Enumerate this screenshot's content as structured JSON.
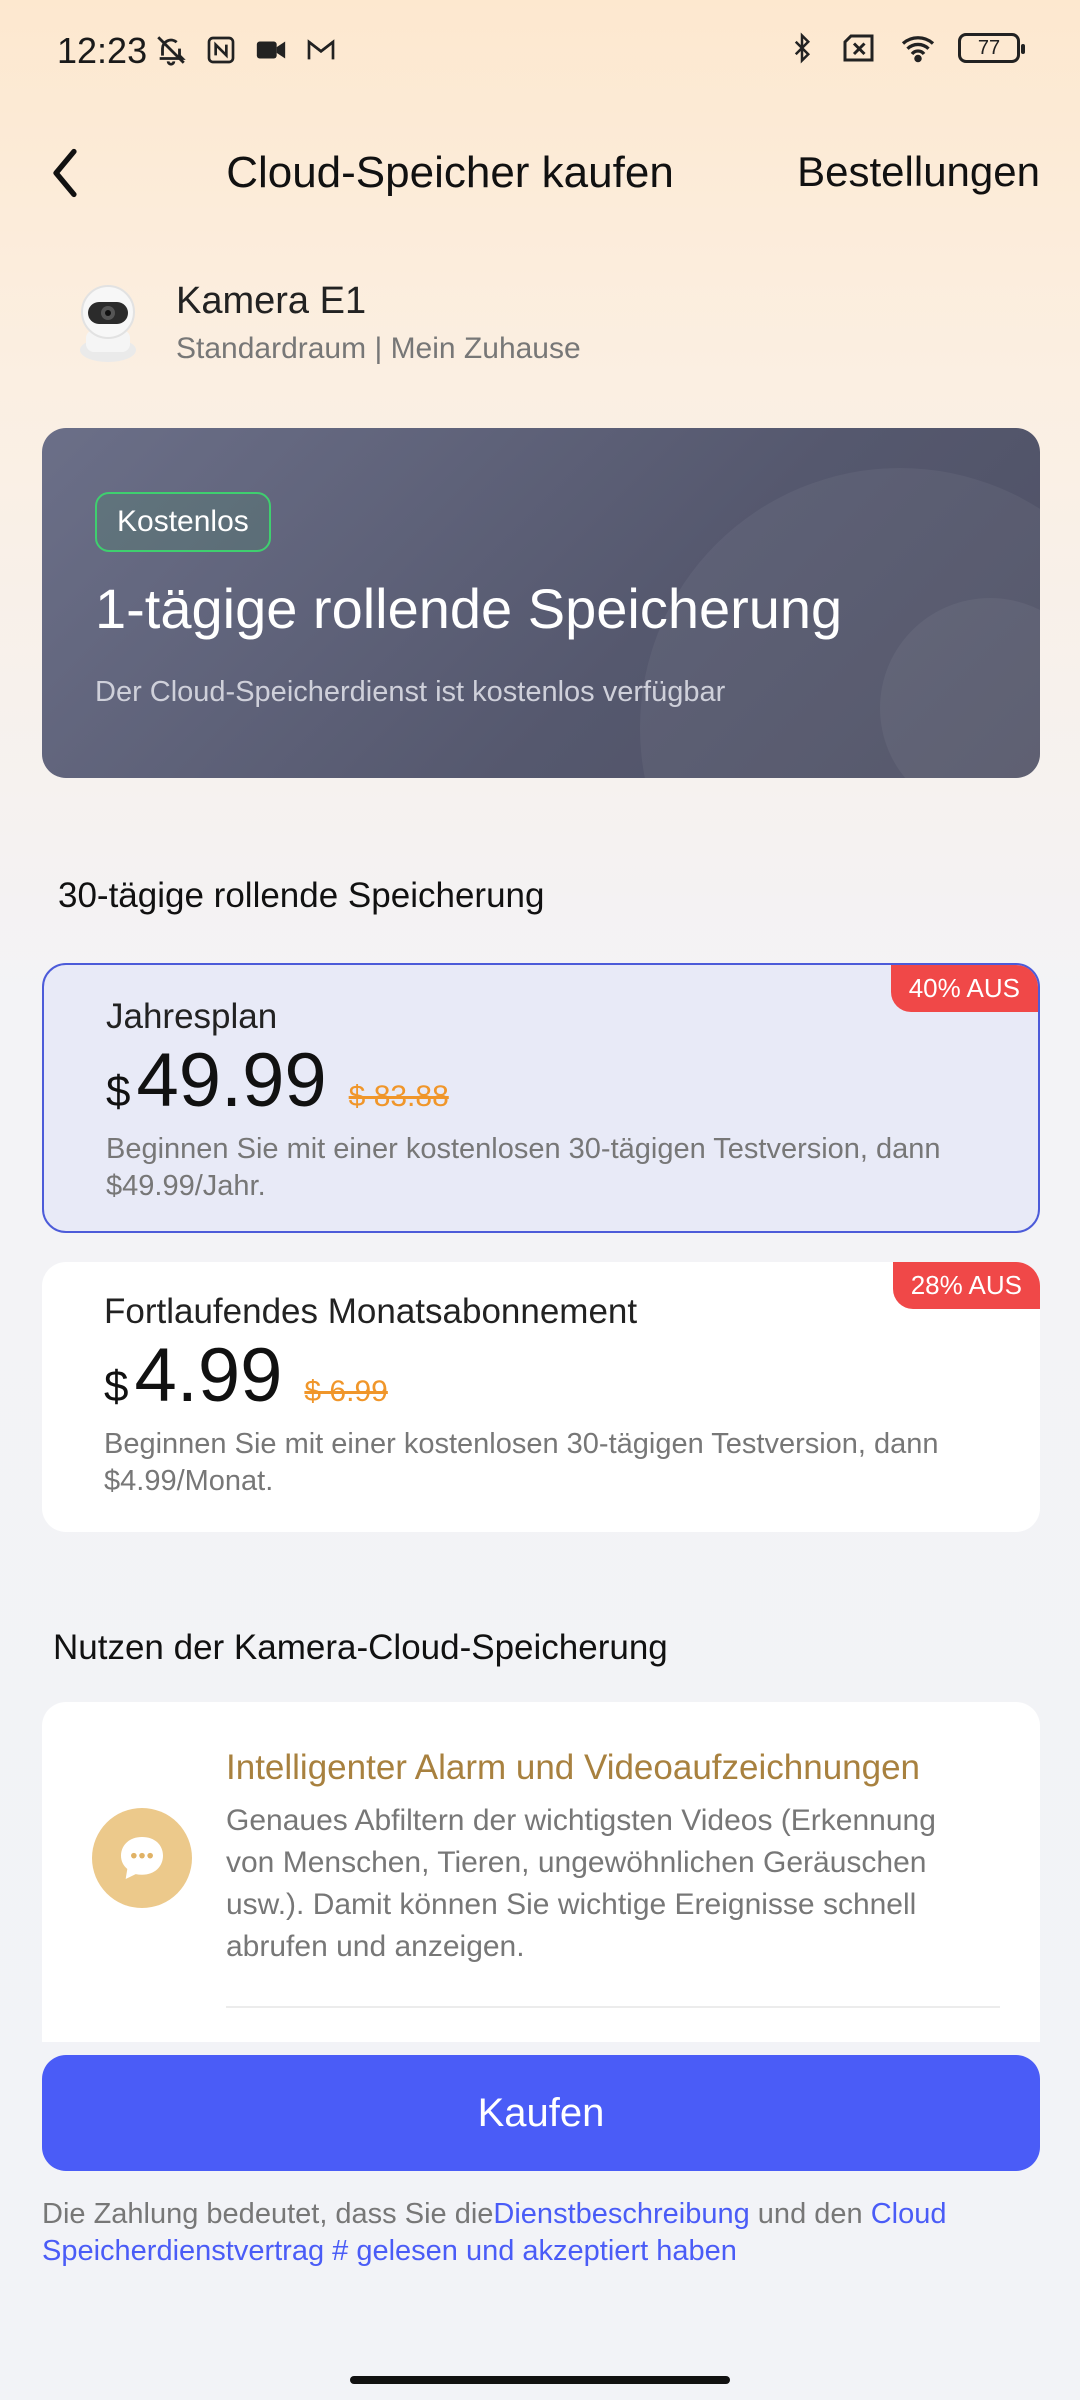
{
  "status_bar": {
    "time": "12:23",
    "battery": "77",
    "icons_left": [
      "muted-bell-icon",
      "nfc-icon",
      "video-camera-icon",
      "gmail-icon"
    ],
    "icons_right": [
      "bluetooth-icon",
      "sim-off-icon",
      "wifi-icon",
      "battery-icon"
    ]
  },
  "header": {
    "title": "Cloud-Speicher kaufen",
    "orders_label": "Bestellungen"
  },
  "device": {
    "name": "Kamera E1",
    "location": "Standardraum | Mein Zuhause"
  },
  "free_plan": {
    "badge": "Kostenlos",
    "title": "1-tägige rollende Speicherung",
    "description": "Der Cloud-Speicherdienst ist kostenlos verfügbar"
  },
  "plans_section": {
    "title": "30-tägige rollende Speicherung",
    "plans": [
      {
        "name": "Jahresplan",
        "currency": "$",
        "price": "49.99",
        "old_price": "$ 83.88",
        "discount": "40% AUS",
        "description": "Beginnen Sie mit einer kostenlosen 30-tägigen Testversion, dann $49.99/Jahr.",
        "selected": true
      },
      {
        "name": "Fortlaufendes Monatsabonnement",
        "currency": "$",
        "price": "4.99",
        "old_price": "$ 6.99",
        "discount": "28% AUS",
        "description": "Beginnen Sie mit einer kostenlosen 30-tägigen Testversion, dann $4.99/Monat.",
        "selected": false
      }
    ]
  },
  "benefits_section": {
    "title": "Nutzen der Kamera-Cloud-Speicherung",
    "items": [
      {
        "icon": "chat-bubble-icon",
        "title": "Intelligenter Alarm und Videoaufzeichnungen",
        "text": "Genaues Abfiltern der wichtigsten Videos (Erkennung von Menschen, Tieren, ungewöhnlichen Geräuschen usw.). Damit können Sie wichtige Ereignisse schnell abrufen und anzeigen."
      }
    ]
  },
  "buy_button": {
    "label": "Kaufen"
  },
  "legal": {
    "prefix": "Die Zahlung bedeutet, dass Sie die",
    "link1": "Dienstbeschreibung",
    "middle": " und den ",
    "link2": "Cloud Speicherdienstvertrag # gelesen und akzeptiert haben"
  },
  "colors": {
    "accent": "#4a5cf7",
    "discount": "#f04848",
    "old_price": "#f0962a",
    "benefit_title": "#a8813f"
  }
}
